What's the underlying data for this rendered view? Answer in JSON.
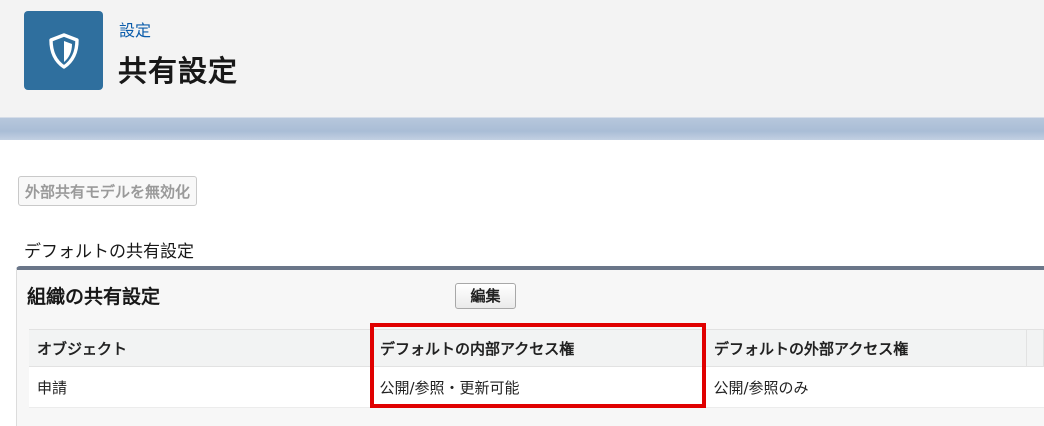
{
  "header": {
    "breadcrumb": "設定",
    "title": "共有設定",
    "icon": "shield-icon",
    "icon_bg": "#2f6f9e"
  },
  "actions": {
    "disable_external_model_label": "外部共有モデルを無効化"
  },
  "section": {
    "heading": "デフォルトの共有設定"
  },
  "org_panel": {
    "title": "組織の共有設定",
    "edit_label": "編集",
    "columns": [
      "オブジェクト",
      "デフォルトの内部アクセス権",
      "デフォルトの外部アクセス権"
    ],
    "rows": [
      [
        "申請",
        "公開/参照・更新可能",
        "公開/参照のみ"
      ]
    ]
  },
  "colors": {
    "highlight_border": "#e00000",
    "breadcrumb_link": "#0b5cab",
    "panel_accent": "#6a7689"
  }
}
